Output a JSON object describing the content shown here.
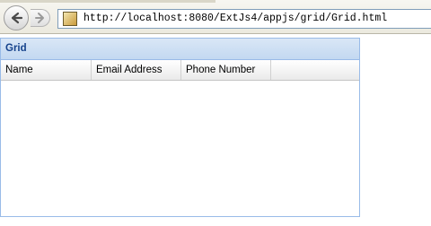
{
  "browser": {
    "url": "http://localhost:8080/ExtJs4/appjs/grid/Grid.html",
    "icons": {
      "back": "back-arrow-icon",
      "forward": "forward-arrow-icon",
      "favicon": "page-favicon-icon"
    }
  },
  "grid": {
    "title": "Grid",
    "columns": [
      {
        "label": "Name"
      },
      {
        "label": "Email Address"
      },
      {
        "label": "Phone Number"
      }
    ],
    "rows": []
  },
  "colors": {
    "panel_title": "#15428b",
    "panel_border": "#99bbe8",
    "header_bg": "#c3d8f1"
  }
}
